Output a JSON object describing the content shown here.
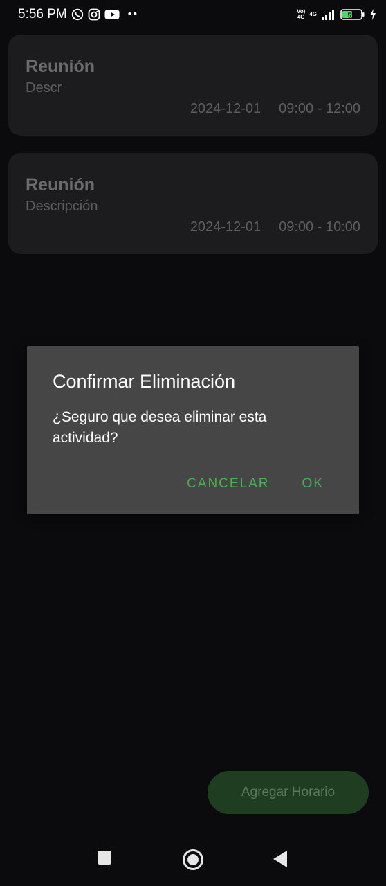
{
  "status_bar": {
    "time": "5:56 PM",
    "left_icons": [
      "whatsapp-icon",
      "instagram-icon",
      "youtube-icon"
    ],
    "more_indicator": "••",
    "network_label_top": "Vo) ",
    "network_label_bottom": "4G",
    "network_4g": "4G",
    "battery_level": "51"
  },
  "activities": [
    {
      "title": "Reunión",
      "description": "Descr",
      "date": "2024-12-01",
      "time_range": "09:00 - 12:00"
    },
    {
      "title": "Reunión",
      "description": "Descripción",
      "date": "2024-12-01",
      "time_range": "09:00 - 10:00"
    }
  ],
  "dialog": {
    "title": "Confirmar Eliminación",
    "message": "¿Seguro que desea eliminar esta actividad?",
    "cancel_label": "CANCELAR",
    "ok_label": "OK"
  },
  "fab": {
    "label": "Agregar Horario"
  },
  "colors": {
    "background": "#0b0b0d",
    "card": "#1c1c1e",
    "dialog": "#464646",
    "accent": "#4caf50",
    "fab": "#1f3d20"
  },
  "nav_bar": {
    "icons": [
      "recent-apps-icon",
      "home-icon",
      "back-icon"
    ]
  }
}
